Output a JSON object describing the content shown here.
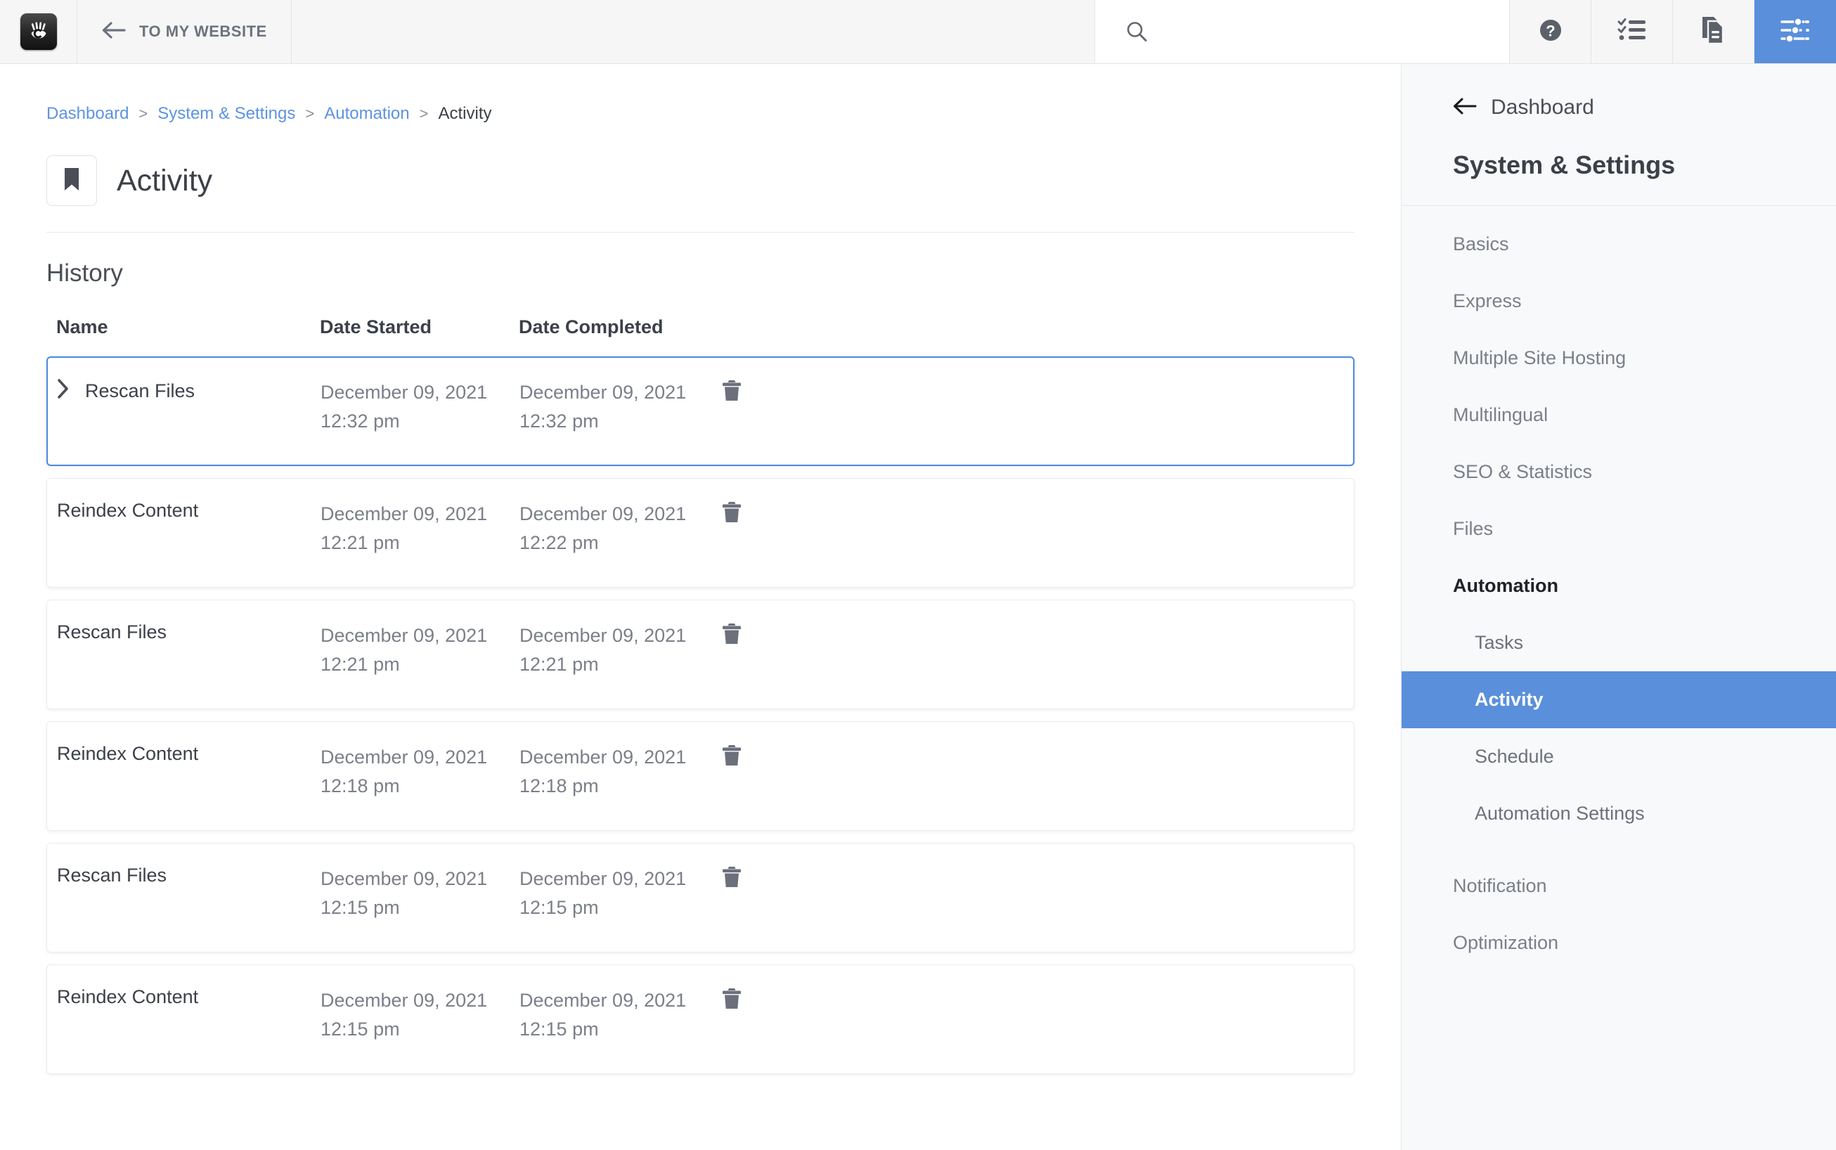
{
  "topbar": {
    "logo_icon": "concrete-hand-logo",
    "to_website_label": "TO MY WEBSITE",
    "back_arrow_icon": "arrow-left-icon",
    "search": {
      "icon": "search-icon",
      "value": "",
      "placeholder": ""
    },
    "icons": [
      {
        "name": "help-icon",
        "active": false
      },
      {
        "name": "checklist-icon",
        "active": false
      },
      {
        "name": "pages-icon",
        "active": false
      },
      {
        "name": "sliders-icon",
        "active": true
      }
    ],
    "active_color": "#5a8fdb"
  },
  "breadcrumb": {
    "items": [
      {
        "label": "Dashboard",
        "link": true
      },
      {
        "label": "System & Settings",
        "link": true
      },
      {
        "label": "Automation",
        "link": true
      },
      {
        "label": "Activity",
        "link": false
      }
    ],
    "separator": ">"
  },
  "page": {
    "bookmark_icon": "bookmark-icon",
    "title": "Activity",
    "section_title": "History"
  },
  "table": {
    "columns": {
      "name": "Name",
      "date_started": "Date Started",
      "date_completed": "Date Completed"
    },
    "delete_icon": "trash-icon",
    "expand_icon": "chevron-right-icon",
    "rows": [
      {
        "name": "Rescan Files",
        "date_started": "December 09, 2021 12:32 pm",
        "date_completed": "December 09, 2021 12:32 pm",
        "expandable": true,
        "selected": true
      },
      {
        "name": "Reindex Content",
        "date_started": "December 09, 2021 12:21 pm",
        "date_completed": "December 09, 2021 12:22 pm",
        "expandable": false,
        "selected": false
      },
      {
        "name": "Rescan Files",
        "date_started": "December 09, 2021 12:21 pm",
        "date_completed": "December 09, 2021 12:21 pm",
        "expandable": false,
        "selected": false
      },
      {
        "name": "Reindex Content",
        "date_started": "December 09, 2021 12:18 pm",
        "date_completed": "December 09, 2021 12:18 pm",
        "expandable": false,
        "selected": false
      },
      {
        "name": "Rescan Files",
        "date_started": "December 09, 2021 12:15 pm",
        "date_completed": "December 09, 2021 12:15 pm",
        "expandable": false,
        "selected": false
      },
      {
        "name": "Reindex Content",
        "date_started": "December 09, 2021 12:15 pm",
        "date_completed": "December 09, 2021 12:15 pm",
        "expandable": false,
        "selected": false
      }
    ]
  },
  "sidebar": {
    "back_label": "Dashboard",
    "back_icon": "arrow-left-icon",
    "heading": "System & Settings",
    "items": [
      {
        "label": "Basics",
        "style": "normal"
      },
      {
        "label": "Express",
        "style": "normal"
      },
      {
        "label": "Multiple Site Hosting",
        "style": "normal"
      },
      {
        "label": "Multilingual",
        "style": "normal"
      },
      {
        "label": "SEO & Statistics",
        "style": "normal"
      },
      {
        "label": "Files",
        "style": "normal"
      },
      {
        "label": "Automation",
        "style": "bold"
      }
    ],
    "sub_items": [
      {
        "label": "Tasks",
        "active": false
      },
      {
        "label": "Activity",
        "active": true
      },
      {
        "label": "Schedule",
        "active": false
      },
      {
        "label": "Automation Settings",
        "active": false
      }
    ],
    "items_after": [
      {
        "label": "Notification",
        "style": "normal"
      },
      {
        "label": "Optimization",
        "style": "normal"
      }
    ],
    "active_color": "#5a8fdb"
  }
}
